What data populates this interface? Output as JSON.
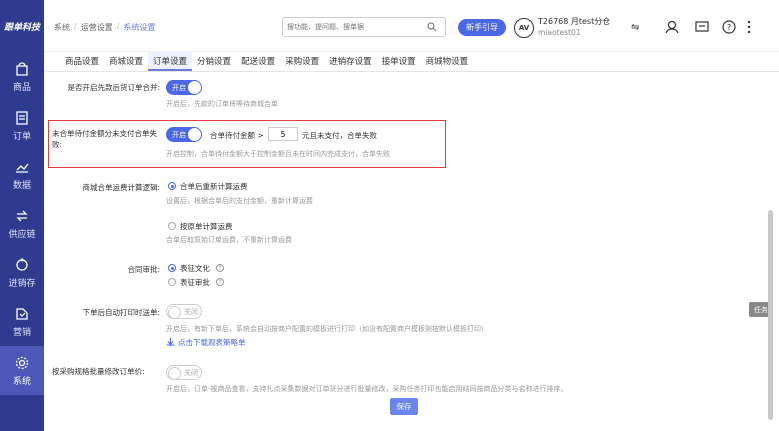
{
  "sidebar": {
    "logo": "跟单科技",
    "items": [
      {
        "label": "商品",
        "icon": "bag-icon"
      },
      {
        "label": "订单",
        "icon": "document-icon"
      },
      {
        "label": "数据",
        "icon": "chart-icon"
      },
      {
        "label": "供应链",
        "icon": "exchange-icon"
      },
      {
        "label": "进销存",
        "icon": "cycle-icon"
      },
      {
        "label": "营销",
        "icon": "tag-icon"
      },
      {
        "label": "系统",
        "icon": "gear-icon"
      }
    ]
  },
  "header": {
    "breadcrumb": [
      "系统",
      "运营设置",
      "系统设置"
    ],
    "search_placeholder": "搜功能、提问题、搜单据",
    "guide_label": "新手引导",
    "account_name": "T26768 月test分仓",
    "account_sub": "miaotest01",
    "avatar_text": "AV"
  },
  "tabs": [
    "商品设置",
    "商城设置",
    "订单设置",
    "分销设置",
    "配送设置",
    "采购设置",
    "进销存设置",
    "接单设置",
    "商城物设置"
  ],
  "settings": {
    "s1_label": "是否开启先款后货订单合并:",
    "s1_toggle": "开启",
    "s1_hint": "开启后，先款的订单将等待商城合单",
    "s2_label": "未合单待付金额分未支付合单失败:",
    "s2_toggle": "开启",
    "s2_text_a": "合单待付金额 >",
    "s2_amount": "5",
    "s2_text_b": "元且未支付，合单失败",
    "s2_hint": "开启控制，合单待付金额大于控制金额且未在时间内完成支付，合单失败",
    "s3_label": "商城合单运费计算逻辑:",
    "s3_opt1": "合单后重新计算运费",
    "s3_opt1_hint": "设置后，根据合单后的支付金额，重新计算运费",
    "s3_opt2": "按原单计算运费",
    "s3_opt2_hint": "合单后取原始订单运费，不重新计算运费",
    "s4_label": "合同审批:",
    "s4_opt1": "表征文化",
    "s4_opt2": "表征审批",
    "s5_label": "下单后自动打印时送单:",
    "s5_toggle": "关闭",
    "s5_hint": "开启后，有新下单后，系统会自动按商户配置的模板进行打印（如没有配置商户模板则按默认模板打印）",
    "s5_link": "点击下载观表策略单",
    "s6_label": "按采购规格批量修改订单价:",
    "s6_toggle": "关闭",
    "s6_hint": "开启后，订单-按商品查看，支持扎点采集数据对订单货分进行批量修改，采购任务打印也能启用结同按商品分类与名称进行排序。"
  },
  "footer": {
    "save_label": "保存",
    "task_label": "任务"
  }
}
